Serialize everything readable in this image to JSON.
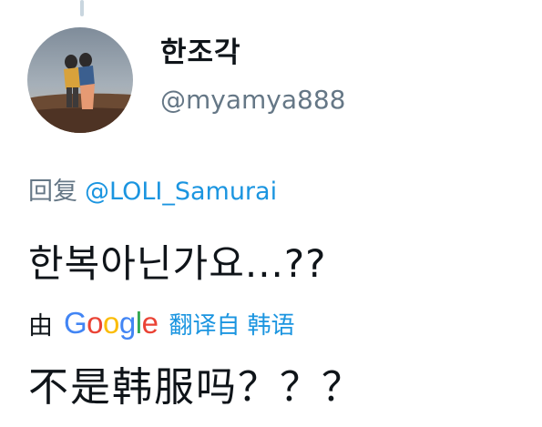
{
  "thread": {
    "connector": "thread-connector"
  },
  "author": {
    "display_name": "한조각",
    "handle": "@myamya888",
    "avatar_icon": "avatar-photo"
  },
  "reply": {
    "prefix": "回复",
    "mention": "@LOLI_Samurai"
  },
  "tweet": {
    "text": "한복아닌가요...??"
  },
  "translation": {
    "by_label": "由",
    "provider": "Google",
    "action": "翻译自",
    "source_language": "韩语",
    "text": "不是韩服吗？？？"
  },
  "colors": {
    "link": "#1b95e0",
    "secondary": "#657786",
    "primary_text": "#0f1419",
    "google_blue": "#4285f4",
    "google_red": "#ea4335",
    "google_yellow": "#fbbc05",
    "google_green": "#34a853"
  }
}
